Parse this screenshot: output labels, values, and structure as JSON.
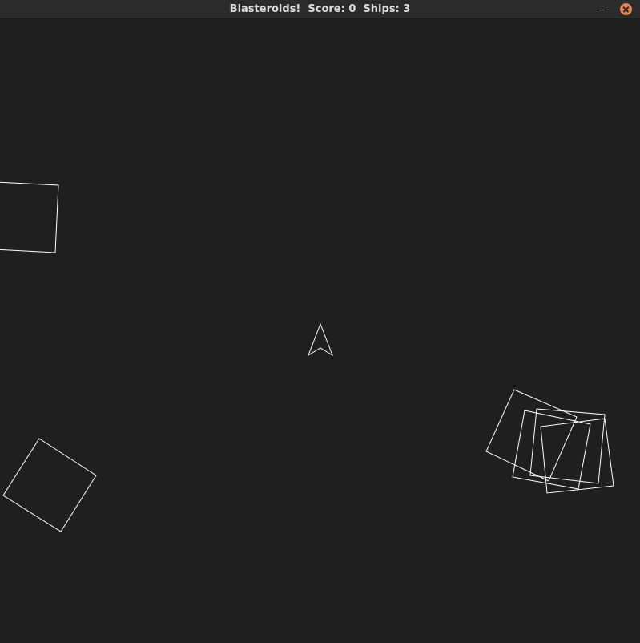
{
  "window": {
    "title": "Blasteroids!  Score: 0  Ships: 3",
    "minimize_label": "–",
    "close_label": "×"
  },
  "game": {
    "name": "Blasteroids!",
    "score": 0,
    "ships": 3,
    "colors": {
      "background": "#1f1f1f",
      "titlebar": "#2b2b2b",
      "outline": "#ffffff",
      "close_button": "#e1875c"
    },
    "sprites": [
      {
        "kind": "ship",
        "icon": "triangle-ship-icon"
      },
      {
        "kind": "asteroid",
        "icon": "square-asteroid-icon"
      },
      {
        "kind": "asteroid",
        "icon": "square-asteroid-icon"
      },
      {
        "kind": "asteroid",
        "icon": "square-asteroid-icon"
      },
      {
        "kind": "asteroid",
        "icon": "square-asteroid-icon"
      },
      {
        "kind": "asteroid",
        "icon": "square-asteroid-icon"
      },
      {
        "kind": "asteroid",
        "icon": "square-asteroid-icon"
      }
    ]
  }
}
